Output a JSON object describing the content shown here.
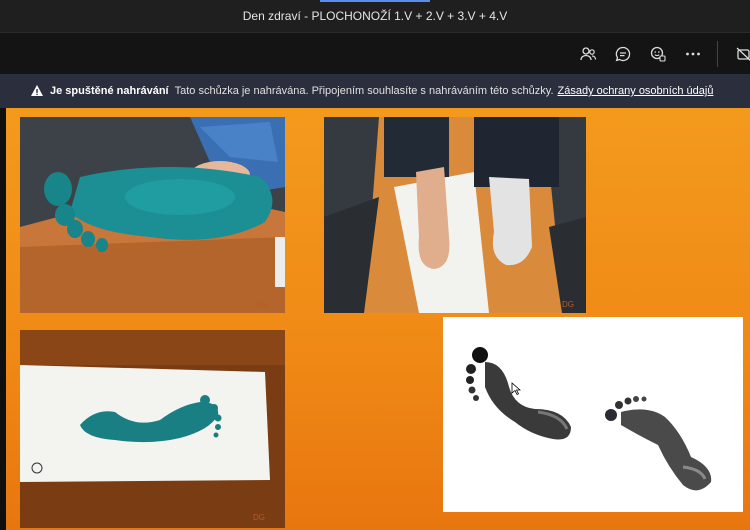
{
  "window": {
    "title": "Den zdraví - PLOCHONOŽÍ 1.V + 2.V + 3.V + 4.V"
  },
  "toolbar": {
    "icons": [
      "people-icon",
      "chat-icon",
      "reactions-icon",
      "more-icon",
      "camera-off-icon"
    ]
  },
  "banner": {
    "label": "Je spuštěné nahrávání",
    "text": "Tato schůzka je nahrávána. Připojením souhlasíte s nahráváním této schůzky.",
    "link": "Zásady ochrany osobních údajů"
  },
  "slide": {
    "watermark": "DG"
  },
  "colors": {
    "accent": "#5b8def",
    "banner_bg": "#2b2f3d",
    "slide_orange": "#f08a16",
    "paint": "#1b8a8a"
  }
}
